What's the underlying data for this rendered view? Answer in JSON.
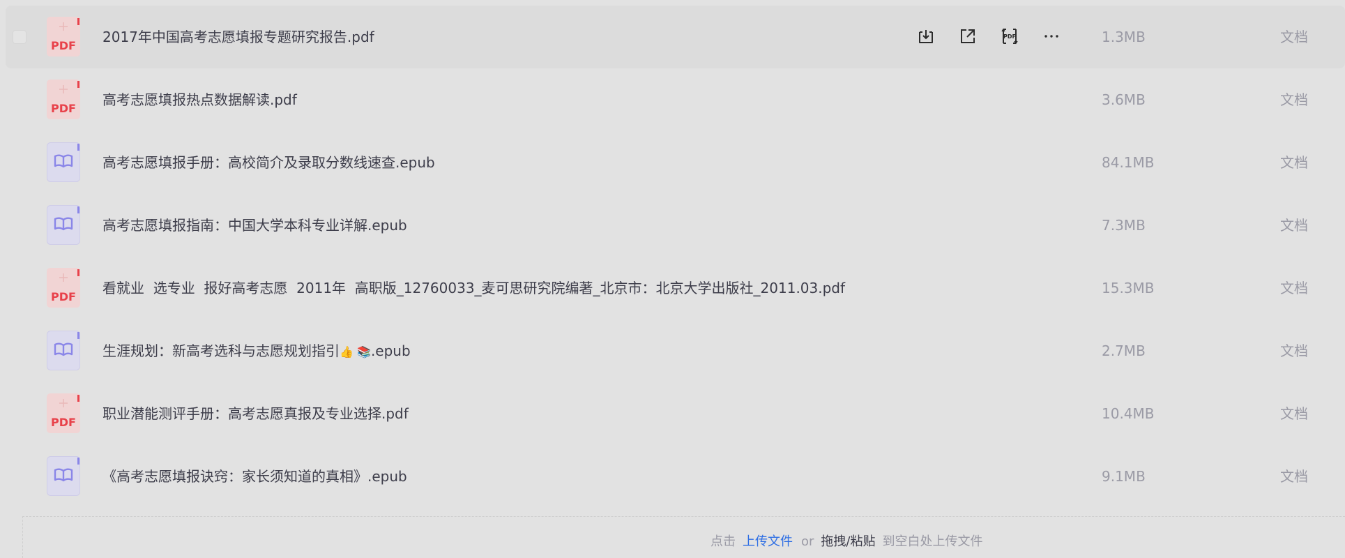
{
  "files": [
    {
      "name": "2017年中国高考志愿填报专题研究报告.pdf",
      "size": "1.3MB",
      "type": "文档",
      "icon": "pdf-file-icon",
      "icon_label": "PDF"
    },
    {
      "name": "高考志愿填报热点数据解读.pdf",
      "size": "3.6MB",
      "type": "文档",
      "icon": "pdf-file-icon",
      "icon_label": "PDF"
    },
    {
      "name": "高考志愿填报手册：高校简介及录取分数线速查.epub",
      "size": "84.1MB",
      "type": "文档",
      "icon": "epub-file-icon"
    },
    {
      "name": "高考志愿填报指南：中国大学本科专业详解.epub",
      "size": "7.3MB",
      "type": "文档",
      "icon": "epub-file-icon"
    },
    {
      "name": "看就业  选专业  报好高考志愿  2011年  高职版_12760033_麦可思研究院编著_北京市：北京大学出版社_2011.03.pdf",
      "size": "15.3MB",
      "type": "文档",
      "icon": "pdf-file-icon",
      "icon_label": "PDF"
    },
    {
      "name": "生涯规划：新高考选科与志愿规划指引",
      "name_emoji": "👍 📚",
      "name_suffix": ".epub",
      "size": "2.7MB",
      "type": "文档",
      "icon": "epub-file-icon"
    },
    {
      "name": "职业潜能测评手册：高考志愿真报及专业选择.pdf",
      "size": "10.4MB",
      "type": "文档",
      "icon": "pdf-file-icon",
      "icon_label": "PDF"
    },
    {
      "name": "《高考志愿填报诀窍：家长须知道的真相》.epub",
      "size": "9.1MB",
      "type": "文档",
      "icon": "epub-file-icon"
    }
  ],
  "row_actions": [
    {
      "name": "download-icon"
    },
    {
      "name": "share-icon"
    },
    {
      "name": "pdf-convert-icon",
      "label": "PDF"
    },
    {
      "name": "more-icon"
    }
  ],
  "upload": {
    "click": "点击",
    "upload_link": "上传文件",
    "or": "or",
    "drag_paste": "拖拽/粘贴",
    "suffix": "到空白处上传文件"
  },
  "colors": {
    "background": "#e2e2e2",
    "hover_row": "#dcdcdc",
    "pdf_red": "#e8414a",
    "epub_purple": "#8a86e8",
    "link_blue": "#2f6fe4"
  }
}
